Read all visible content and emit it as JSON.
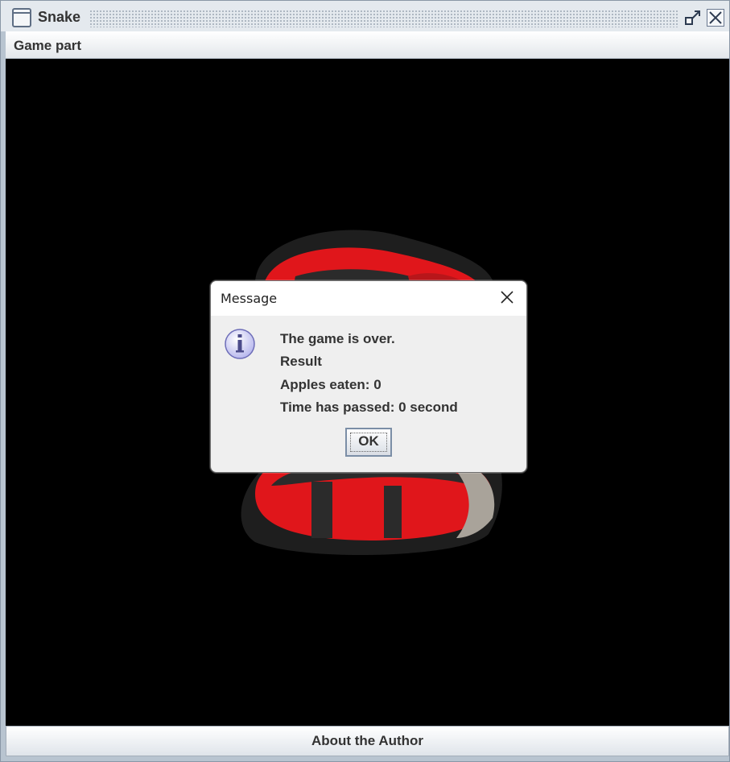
{
  "window": {
    "title": "Snake",
    "icon": "window-icon"
  },
  "titlebar_buttons": {
    "restore": "restore-icon",
    "close": "close-icon"
  },
  "menubar": {
    "items": [
      {
        "label": "Game part"
      }
    ]
  },
  "canvas": {
    "background": "#000000",
    "logo": "snake-logo"
  },
  "footer": {
    "button_label": "About the Author"
  },
  "dialog": {
    "title": "Message",
    "icon": "info-icon",
    "lines": [
      "The game is over.",
      "Result",
      "Apples eaten: 0",
      "Time has passed: 0 second"
    ],
    "ok_label": "OK"
  },
  "colors": {
    "snake_red": "#e0161b",
    "snake_dark": "#2b2b2b",
    "snake_grey": "#a9a39a"
  }
}
